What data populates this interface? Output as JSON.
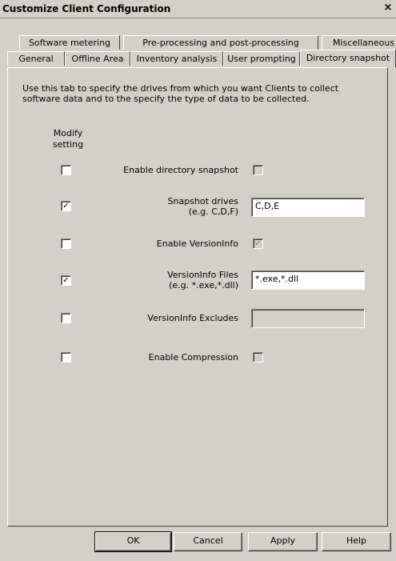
{
  "window": {
    "title": "Customize Client Configuration",
    "close_glyph": "×"
  },
  "tabs": {
    "row_back": [
      {
        "label": "Software metering"
      },
      {
        "label": "Pre-processing and post-processing"
      },
      {
        "label": "Miscellaneous"
      }
    ],
    "row_front": [
      {
        "label": "General"
      },
      {
        "label": "Offline Area"
      },
      {
        "label": "Inventory analysis"
      },
      {
        "label": "User prompting"
      },
      {
        "label": "Directory snapshot",
        "active": true
      }
    ]
  },
  "content": {
    "intro": "Use this tab to specify the drives from which you want Clients to collect software data and to the specify the type of data to be collected.",
    "modify_header": "Modify setting",
    "rows": [
      {
        "label": "Enable directory snapshot",
        "modify_checked": false,
        "value_type": "checkbox",
        "value_checked": false,
        "value_enabled": false
      },
      {
        "label": "Snapshot drives",
        "hint": "(e.g. C,D,F)",
        "modify_checked": true,
        "value_type": "text",
        "value": "C,D,E"
      },
      {
        "label": "Enable VersionInfo",
        "modify_checked": false,
        "value_type": "checkbox",
        "value_checked": true,
        "value_enabled": false
      },
      {
        "label": "VersionInfo Files",
        "hint": "(e.g. *.exe,*.dll)",
        "modify_checked": true,
        "value_type": "text",
        "value": "*.exe,*.dll"
      },
      {
        "label": "VersionInfo Excludes",
        "modify_checked": false,
        "value_type": "text",
        "value": "",
        "value_enabled": false
      },
      {
        "label": "Enable Compression",
        "modify_checked": false,
        "value_type": "checkbox",
        "value_checked": false,
        "value_enabled": false
      }
    ]
  },
  "buttons": {
    "ok": "OK",
    "cancel": "Cancel",
    "apply": "Apply",
    "help": "Help"
  },
  "check_glyph": "✓"
}
